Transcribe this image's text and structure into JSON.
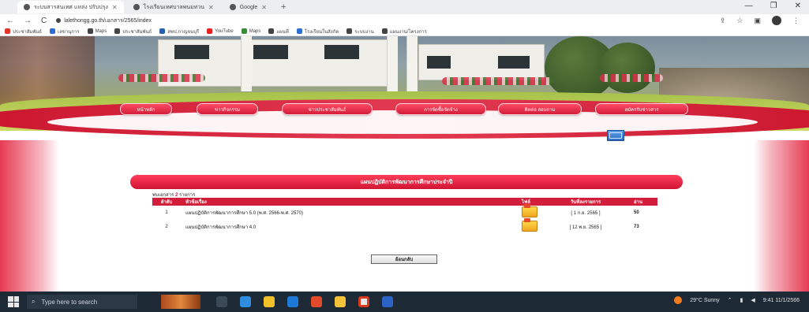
{
  "browser": {
    "tabs": [
      {
        "label": "ระบบสารสนเทศ แหล่ง ปรับปรุง"
      },
      {
        "label": "โรงเรียนเทศบาลพนมทวน"
      },
      {
        "label": "Google"
      }
    ],
    "url": "lalethongg.go.th/เอกสาร/2565/index",
    "bookmarks": [
      "ประชาสัมพันธ์",
      "เลขานุการ",
      "Maps",
      "ประชาสัมพันธ์",
      "สพป.กาญจนบุรี",
      "YouTube",
      "Maps",
      "แผนที่",
      "โรงเรียนในสังกัด",
      "ระบบงาน",
      "แผนงาน/โครงการ"
    ]
  },
  "menu": {
    "items": [
      "หน้าหลัก",
      "ข่าวกิจกรรม",
      "ข่าวประชาสัมพันธ์",
      "การจัดซื้อจัดจ้าง",
      "ติดต่อ สอบถาม",
      "สมัครรับข่าวสาร"
    ]
  },
  "content": {
    "banner_title": "แผนปฏิบัติการพัฒนาการศึกษาประจำปี",
    "count_label": "พบเอกสาร",
    "count_value": "2",
    "count_unit": "รายการ",
    "table": {
      "headers": [
        "ลำดับ",
        "หัวข้อเรื่อง",
        "ไฟล์",
        "วันที่ลงรายการ",
        "อ่าน"
      ],
      "rows": [
        {
          "no": "1",
          "title": "แผนปฏิบัติการพัฒนาการศึกษา 5.0 (พ.ศ. 2566-พ.ศ. 2570)",
          "date": "[ 1 ก.ย. 2565 ]",
          "views": "50"
        },
        {
          "no": "2",
          "title": "แผนปฏิบัติการพัฒนาการศึกษา 4.0",
          "date": "[ 12 พ.ย. 2565 ]",
          "views": "73"
        }
      ]
    },
    "back_button": "ย้อนกลับ"
  },
  "taskbar": {
    "search_placeholder": "Type here to search",
    "weather": "29°C Sunny",
    "time": "9:41",
    "date": "11/1/2566"
  },
  "colors": {
    "accent": "#d21e3a",
    "menu_gradient_top": "#ff4a64"
  },
  "icons": [
    "search-icon",
    "back-icon",
    "forward-icon",
    "reload-icon",
    "file-icon",
    "mail-icon",
    "windows-icon"
  ]
}
